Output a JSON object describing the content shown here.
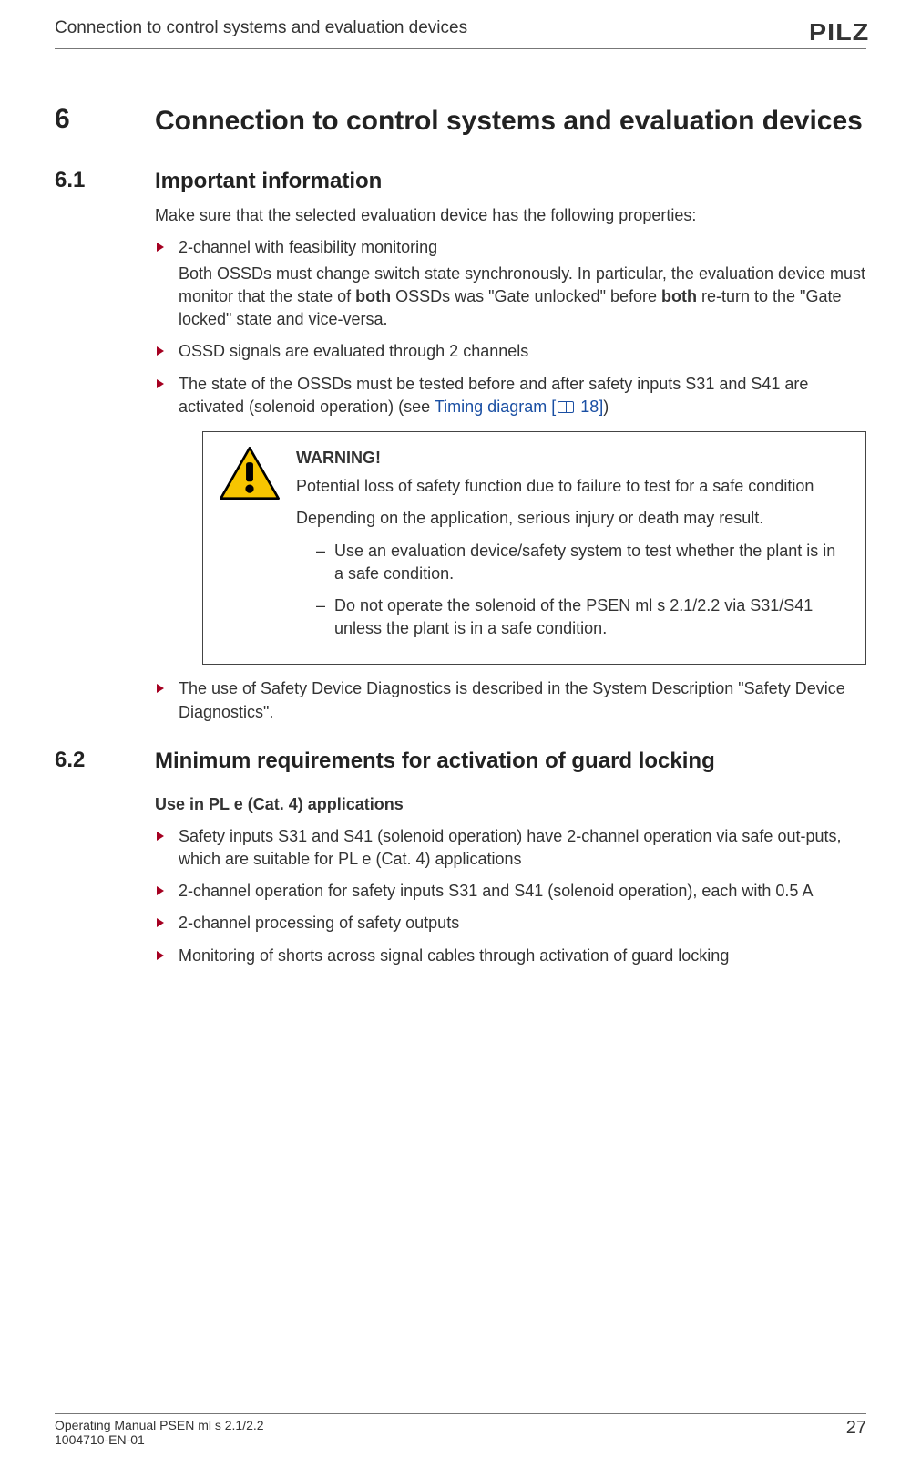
{
  "header": {
    "title": "Connection to control systems and evaluation devices",
    "logo": "PILZ"
  },
  "section": {
    "chapter_num": "6",
    "chapter_title": "Connection to control systems and evaluation devices",
    "s61": {
      "num": "6.1",
      "title": "Important information",
      "intro": "Make sure that the selected evaluation device has the following properties:",
      "b1": "2-channel with feasibility monitoring",
      "b1_sub_a": "Both OSSDs must change switch state synchronously. In particular, the evaluation device must monitor that the state of ",
      "b1_bold1": "both",
      "b1_sub_b": " OSSDs was \"Gate unlocked\" before ",
      "b1_bold2": "both",
      "b1_sub_c": " re-turn to the \"Gate locked\" state and vice-versa.",
      "b2": "OSSD signals are evaluated through 2 channels",
      "b3_a": "The state of the OSSDs must be tested before and after safety inputs S31 and S41 are activated (solenoid operation) (see ",
      "b3_link": "Timing diagram [",
      "b3_link_page": " 18]",
      "b3_b": ")",
      "warn": {
        "title": "WARNING!",
        "l1": "Potential loss of safety function due to failure to test for a safe condition",
        "l2": "Depending on the application, serious injury or death may result.",
        "d1": "Use an evaluation device/safety system to test whether the plant is in a safe condition.",
        "d2": "Do not operate the solenoid of the PSEN ml s 2.1/2.2 via S31/S41 unless the plant is in a safe condition."
      },
      "b4": "The use of Safety Device Diagnostics is described in the System Description \"Safety Device Diagnostics\"."
    },
    "s62": {
      "num": "6.2",
      "title": "Minimum requirements for activation of guard locking",
      "subhead": "Use in PL e (Cat. 4) applications",
      "b1": "Safety inputs S31 and S41 (solenoid operation) have 2-channel operation via safe out-puts, which are suitable for PL e (Cat. 4) applications",
      "b2": "2-channel operation for safety inputs S31 and S41 (solenoid operation), each with 0.5 A",
      "b3": "2-channel processing of safety outputs",
      "b4": "Monitoring of shorts across signal cables through activation of guard locking"
    }
  },
  "footer": {
    "l1": "Operating Manual PSEN ml s 2.1/2.2",
    "l2": "1004710-EN-01",
    "page": "27"
  }
}
